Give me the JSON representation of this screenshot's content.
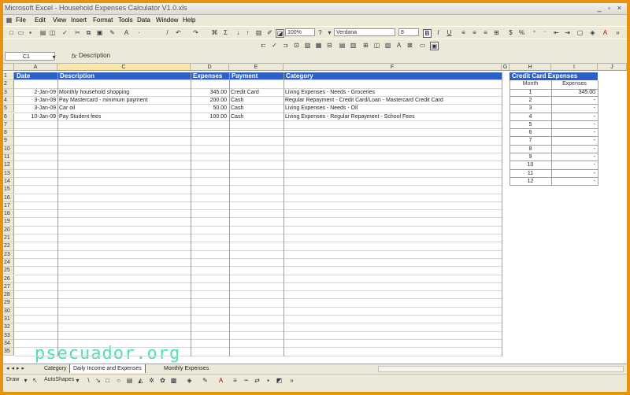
{
  "window": {
    "title": "Microsoft Excel - Household Expenses Calculator V1.0.xls",
    "controls": "_ ▫ ×"
  },
  "menu": [
    "File",
    "Edit",
    "View",
    "Insert",
    "Format",
    "Tools",
    "Data",
    "Window",
    "Help"
  ],
  "toolbar": {
    "zoom": "100%",
    "font": "Verdana",
    "size": "8",
    "bold": "B",
    "italic": "I",
    "underline": "U",
    "sigma": "Σ",
    "currency": "$",
    "percent": "%"
  },
  "formula_bar": {
    "name_box": "C1",
    "fx": "fx",
    "content": "Description"
  },
  "columns": [
    "A",
    "C",
    "D",
    "E",
    "F",
    "G",
    "H",
    "I",
    "J"
  ],
  "table_headers": {
    "date": "Date",
    "description": "Description",
    "expenses": "Expenses",
    "payment": "Payment",
    "category": "Category"
  },
  "rows": [
    {
      "date": "2-Jan-09",
      "description": "Monthly household shopping",
      "expenses": "345.00",
      "payment": "Credit Card",
      "category": "Living Expenses - Needs - Groceries"
    },
    {
      "date": "3-Jan-09",
      "description": "Pay Mastercard - minimum payment",
      "expenses": "200.00",
      "payment": "Cash",
      "category": "Regular Repayment - Credit Card/Loan - Mastercard Credit Card"
    },
    {
      "date": "3-Jan-09",
      "description": "Car oil",
      "expenses": "50.00",
      "payment": "Cash",
      "category": "Living Expenses - Needs - Oil"
    },
    {
      "date": "10-Jan-09",
      "description": "Pay Student fees",
      "expenses": "100.00",
      "payment": "Cash",
      "category": "Living Expenses - Regular Repayment - School Fees"
    }
  ],
  "row_numbers": [
    "1",
    "2",
    "3",
    "4",
    "5",
    "6",
    "7",
    "8",
    "9",
    "10",
    "11",
    "12",
    "13",
    "14",
    "15",
    "16",
    "17",
    "18",
    "19",
    "20",
    "21",
    "22",
    "23",
    "24",
    "25",
    "26",
    "27",
    "28",
    "29",
    "30",
    "31",
    "32",
    "33",
    "34",
    "35"
  ],
  "credit_card": {
    "title": "Credit Card Expenses",
    "month_label": "Month",
    "expenses_label": "Expenses",
    "months": [
      "1",
      "2",
      "3",
      "4",
      "5",
      "6",
      "7",
      "8",
      "9",
      "10",
      "11",
      "12"
    ],
    "values": [
      "345.00",
      "-",
      "-",
      "-",
      "-",
      "-",
      "-",
      "-",
      "-",
      "-",
      "-",
      "-"
    ]
  },
  "watermark": "psecuador.org",
  "sheet_tabs": [
    "Category",
    "Daily Income and Expenses",
    "Monthly Expenses"
  ],
  "active_tab": 1,
  "drawing": {
    "draw_label": "Draw",
    "autoshapes_label": "AutoShapes"
  },
  "colors": {
    "header_blue": "#2c60c8",
    "frame_orange": "#e8930f",
    "watermark": "#25e0a6"
  }
}
